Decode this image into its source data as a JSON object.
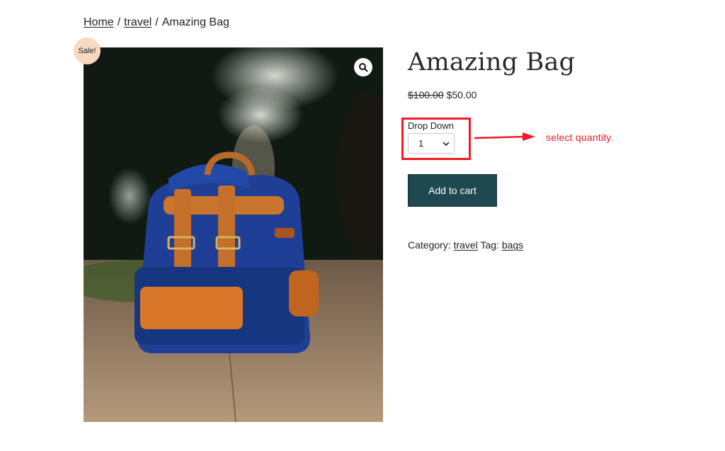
{
  "breadcrumb": {
    "home": "Home",
    "category": "travel",
    "current": "Amazing Bag",
    "separator": "/"
  },
  "product": {
    "badge": "Sale!",
    "title": "Amazing Bag",
    "price_old": "$100.00",
    "price_new": "$50.00",
    "image_icon": "backpack-photo"
  },
  "variation": {
    "label": "Drop Down",
    "selected": "1"
  },
  "annotation": {
    "text": "select quantity.",
    "color": "#ee1c24"
  },
  "cart": {
    "button_label": "Add to cart",
    "button_color": "#1f4950"
  },
  "meta": {
    "category_label": "Category:",
    "category_value": "travel",
    "tag_label": "Tag:",
    "tag_value": "bags"
  },
  "icons": {
    "zoom": "magnifier-icon",
    "dropdown": "chevron-down-icon"
  }
}
